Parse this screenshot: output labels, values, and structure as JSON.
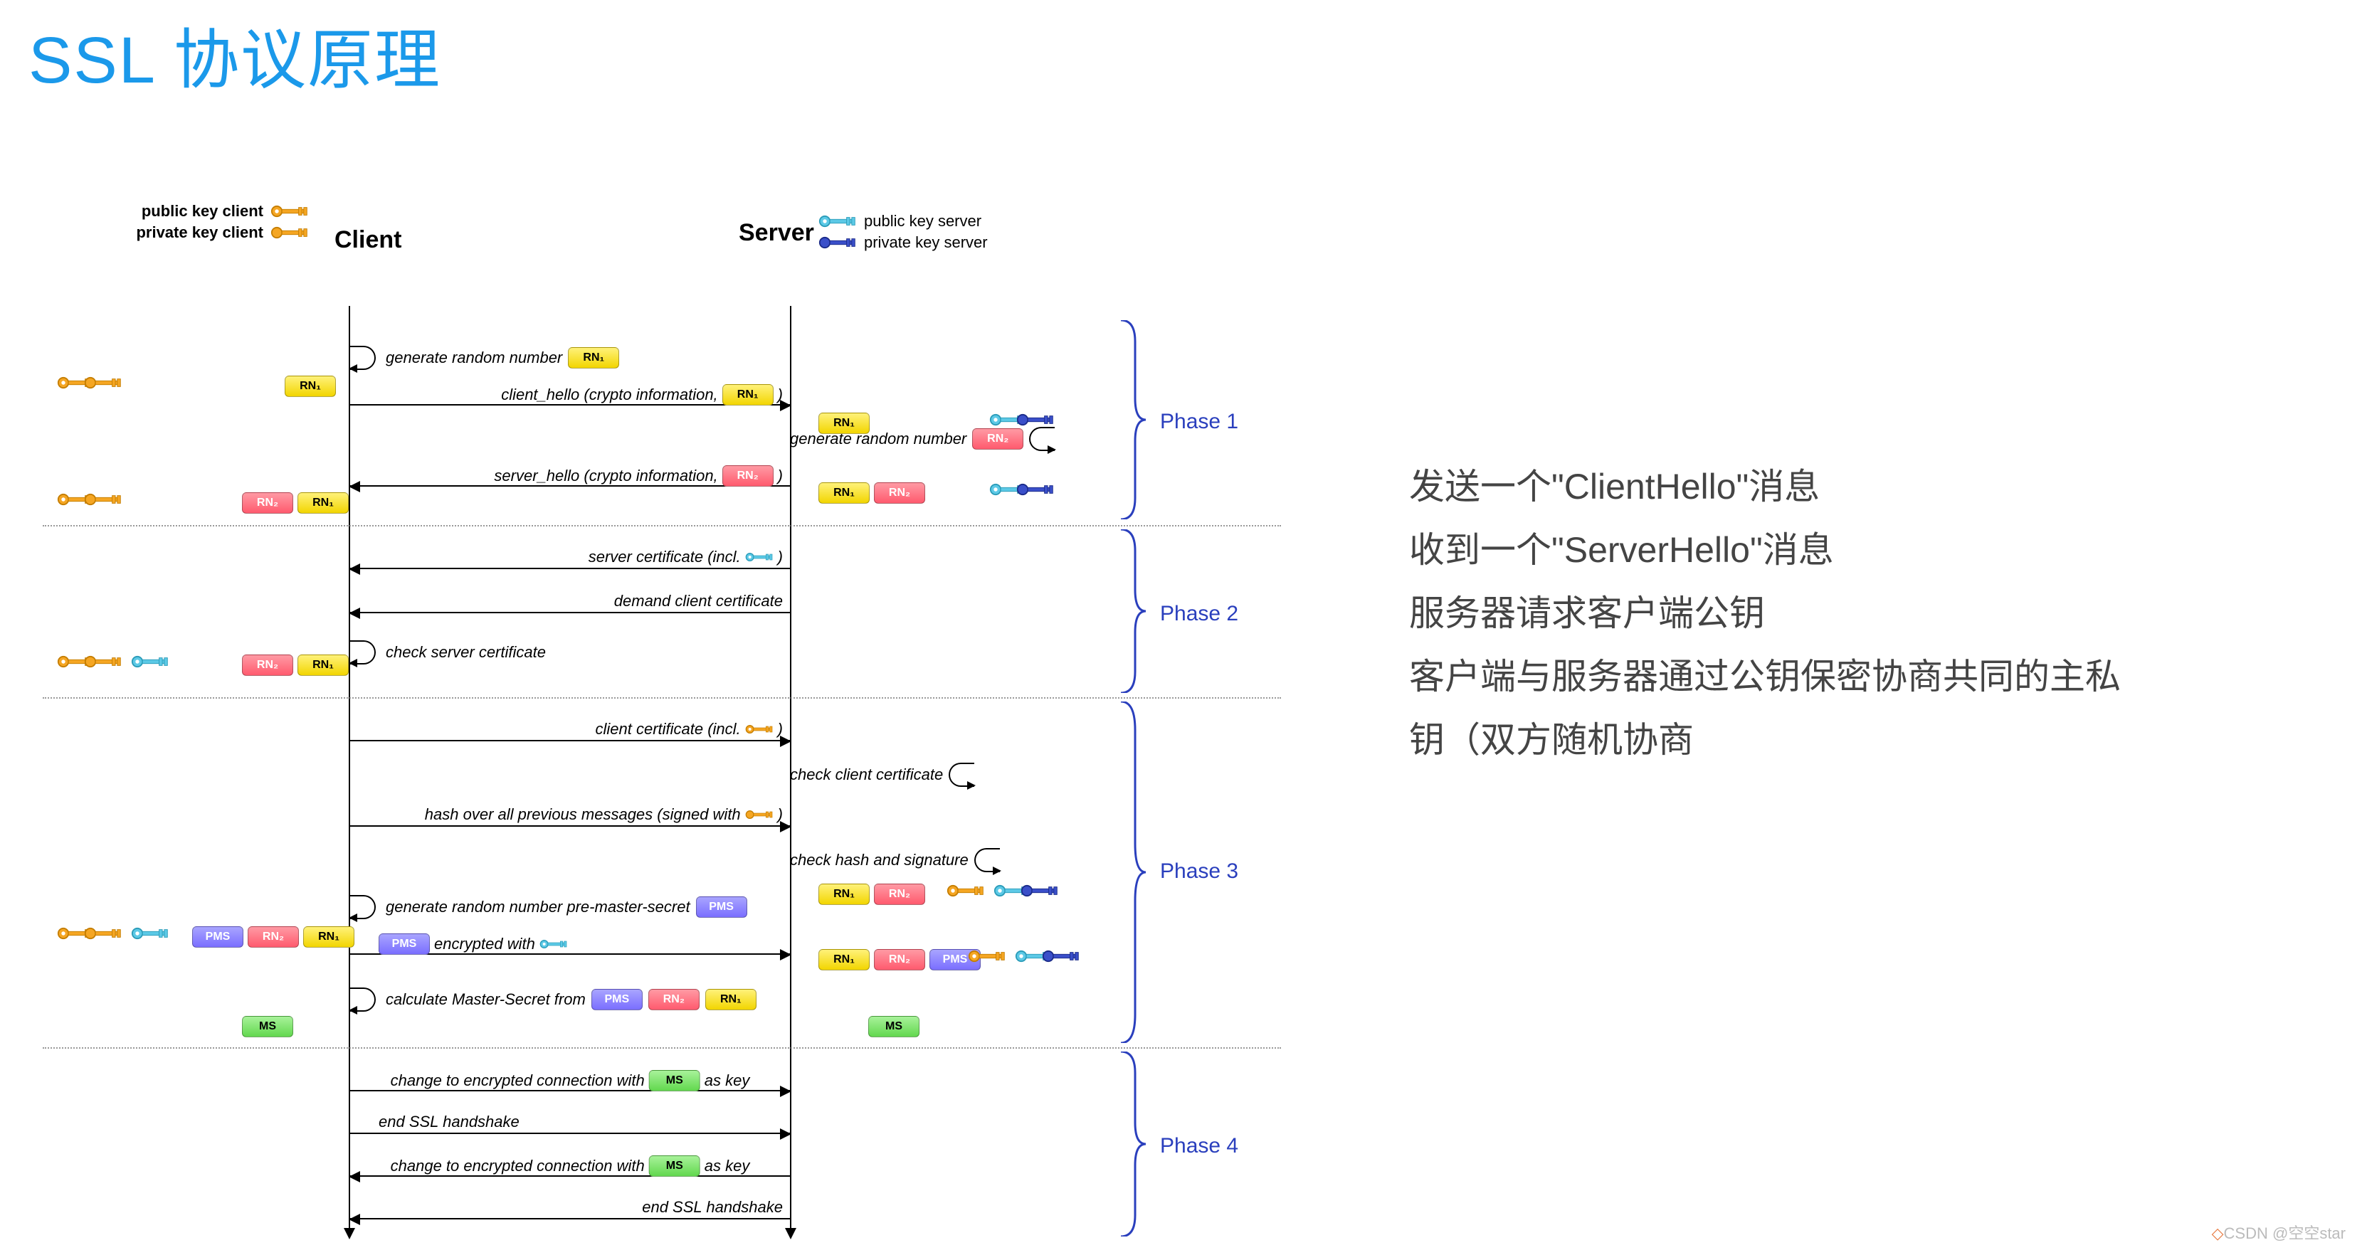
{
  "title": "SSL 协议原理",
  "legend": {
    "public_client": "public key client",
    "private_client": "private key client",
    "client": "Client",
    "server": "Server",
    "public_server": "public key server",
    "private_server": "private key server"
  },
  "badges": {
    "rn1": "RN₁",
    "rn2": "RN₂",
    "pms": "PMS",
    "ms": "MS"
  },
  "steps": {
    "gen_rn1": "generate random number",
    "client_hello": "client_hello (crypto information,",
    "gen_rn2": "generate random number",
    "server_hello": "server_hello (crypto information,",
    "server_cert": "server certificate (incl.",
    "demand_client_cert": "demand client certificate",
    "check_server_cert": "check server certificate",
    "client_cert": "client certificate (incl.",
    "check_client_cert": "check client certificate",
    "hash_signed": "hash over all previous messages (signed with",
    "check_hash": "check hash and signature",
    "gen_pms": "generate random number pre-master-secret",
    "pms_enc": "encrypted with",
    "calc_ms": "calculate Master-Secret from",
    "change_enc": "change to encrypted connection with",
    "as_key": "as key",
    "end_ssl": "end SSL handshake"
  },
  "phases": {
    "p1": "Phase 1",
    "p2": "Phase 2",
    "p3": "Phase 3",
    "p4": "Phase 4"
  },
  "explain": {
    "l1": "发送一个\"ClientHello\"消息",
    "l2": "收到一个\"ServerHello\"消息",
    "l3": "服务器请求客户端公钥",
    "l4": "客户端与服务器通过公钥保密协商共同的主私",
    "l5": "钥（双方随机协商"
  },
  "watermark": "CSDN @空空star"
}
